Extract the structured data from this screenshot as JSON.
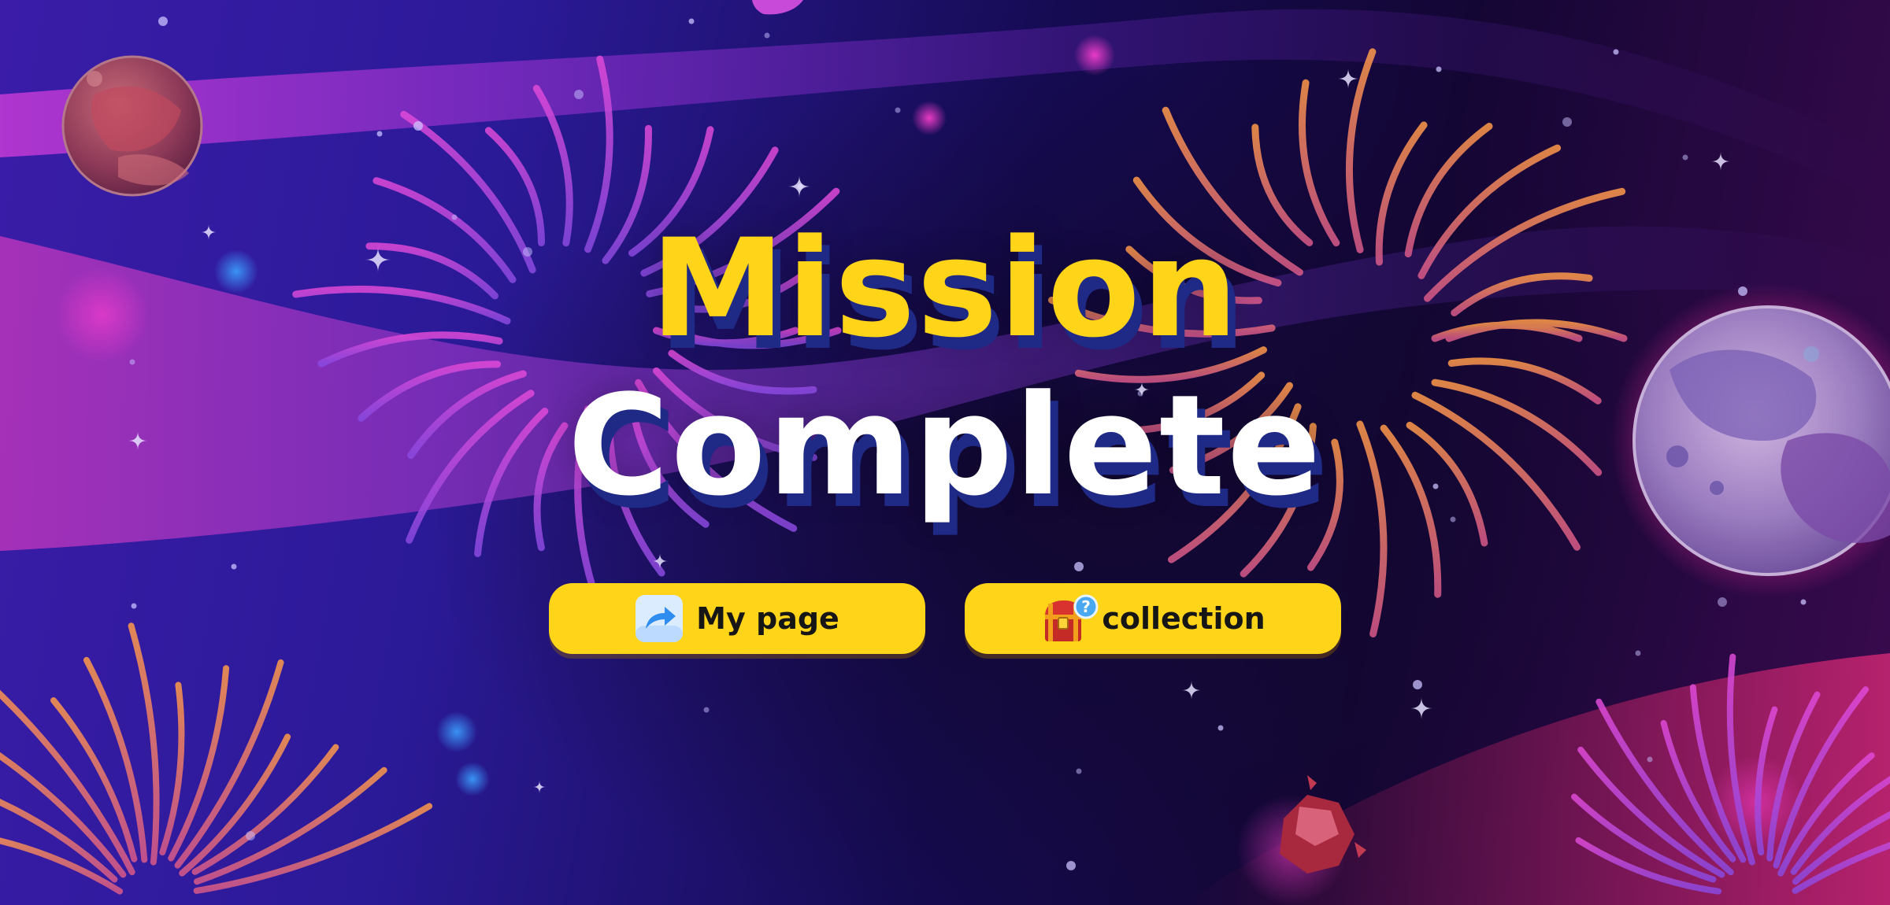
{
  "title": {
    "line1": "Mission",
    "line2": "Complete"
  },
  "buttons": {
    "my_page": {
      "label": "My page",
      "icon": "share-arrow-icon"
    },
    "collection": {
      "label": "collection",
      "icon": "treasure-chest-icon"
    }
  },
  "colors": {
    "title_yellow": "#ffd419",
    "title_white": "#ffffff",
    "title_shadow": "#1f2a86",
    "button_bg": "#ffd419",
    "button_text": "#161616"
  },
  "decorations": [
    "firework-icon",
    "planet-icon",
    "star-icon",
    "meteor-icon"
  ]
}
